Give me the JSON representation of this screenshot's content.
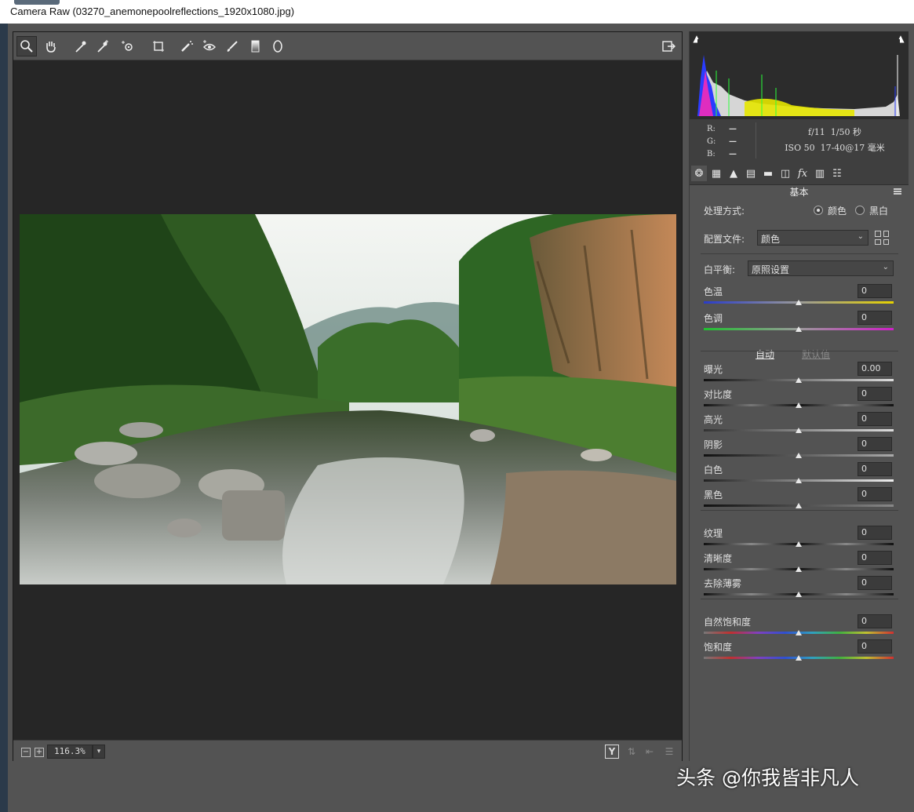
{
  "window": {
    "title": "Camera Raw (03270_anemonepoolreflections_1920x1080.jpg)"
  },
  "toolbar": {
    "tools": [
      "zoom-tool",
      "hand-tool",
      "white-balance-tool",
      "color-sampler-tool",
      "targeted-adjustment-tool",
      "crop-tool",
      "spot-removal-tool",
      "red-eye-tool",
      "adjustment-brush-tool",
      "graduated-filter-tool",
      "radial-filter-tool"
    ],
    "export_icon": "open-preferences-icon"
  },
  "statusbar": {
    "zoom": "116.3%",
    "zoom_out": "−",
    "zoom_in": "+",
    "before_after": "Y"
  },
  "histogram": {
    "rgb": {
      "r_label": "R:",
      "g_label": "G:",
      "b_label": "B:",
      "r": "—",
      "g": "—",
      "b": "—"
    },
    "exif": {
      "aperture": "f/11",
      "shutter": "1/50 秒",
      "iso": "ISO 50",
      "lens": "17-40@17 毫米"
    }
  },
  "panel": {
    "section_title": "基本",
    "treatment": {
      "label": "处理方式:",
      "color": "颜色",
      "bw": "黑白",
      "selected": "color"
    },
    "profile": {
      "label": "配置文件:",
      "value": "颜色"
    },
    "white_balance": {
      "label": "白平衡:",
      "value": "原照设置"
    },
    "auto_label": "自动",
    "default_label": "默认值",
    "sliders": [
      {
        "label": "色温",
        "value": "0",
        "pos": 0.5
      },
      {
        "label": "色调",
        "value": "0",
        "pos": 0.5
      },
      {
        "label": "曝光",
        "value": "0.00",
        "pos": 0.5
      },
      {
        "label": "对比度",
        "value": "0",
        "pos": 0.5
      },
      {
        "label": "高光",
        "value": "0",
        "pos": 0.5
      },
      {
        "label": "阴影",
        "value": "0",
        "pos": 0.5
      },
      {
        "label": "白色",
        "value": "0",
        "pos": 0.5
      },
      {
        "label": "黑色",
        "value": "0",
        "pos": 0.5
      },
      {
        "label": "纹理",
        "value": "0",
        "pos": 0.5
      },
      {
        "label": "清晰度",
        "value": "0",
        "pos": 0.5
      },
      {
        "label": "去除薄雾",
        "value": "0",
        "pos": 0.5
      },
      {
        "label": "自然饱和度",
        "value": "0",
        "pos": 0.5
      },
      {
        "label": "饱和度",
        "value": "0",
        "pos": 0.5
      }
    ]
  },
  "watermark": {
    "text": "头条 @你我皆非凡人"
  },
  "colors": {
    "panel": "#535353",
    "preview_bg": "#262626",
    "title_bg": "#ffffff"
  }
}
